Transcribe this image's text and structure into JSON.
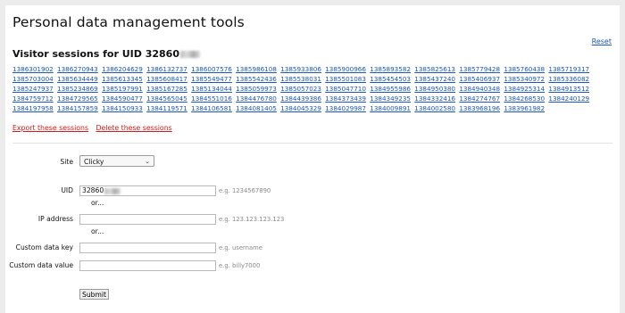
{
  "page": {
    "title": "Personal data management tools",
    "reset_label": "Reset"
  },
  "sessions": {
    "title": "Visitor sessions for UID 32860",
    "ids": [
      "1386301902",
      "1386270943",
      "1386204629",
      "1386132737",
      "1386007576",
      "1385986108",
      "1385933806",
      "1385900966",
      "1385893582",
      "1385825613",
      "1385779428",
      "1385760438",
      "1385719317",
      "1385703004",
      "1385634449",
      "1385613345",
      "1385608417",
      "1385549477",
      "1385542436",
      "1385538031",
      "1385501083",
      "1385454503",
      "1385437240",
      "1385406937",
      "1385340972",
      "1385336082",
      "1385247937",
      "1385234869",
      "1385197991",
      "1385167285",
      "1385134044",
      "1385059973",
      "1385057023",
      "1385047710",
      "1384955986",
      "1384950380",
      "1384940348",
      "1384925314",
      "1384913512",
      "1384759712",
      "1384729565",
      "1384590477",
      "1384565045",
      "1384551016",
      "1384476780",
      "1384439386",
      "1384373439",
      "1384349235",
      "1384332416",
      "1384274767",
      "1384268530",
      "1384240129",
      "1384197958",
      "1384157859",
      "1384150933",
      "1384119571",
      "1384106581",
      "1384081405",
      "1384045329",
      "1384029987",
      "1384009891",
      "1384002580",
      "1383968196",
      "1383961982"
    ]
  },
  "actions": {
    "export_label": "Export these sessions",
    "delete_label": "Delete these sessions"
  },
  "form": {
    "site_label": "Site",
    "site_value": "Clicky",
    "uid_label": "UID",
    "uid_value": "32860",
    "uid_hint": "e.g. 1234567890",
    "or_text": "or...",
    "ip_label": "IP address",
    "ip_value": "",
    "ip_hint": "e.g. 123.123.123.123",
    "custom_key_label": "Custom data key",
    "custom_key_value": "",
    "custom_key_hint": "e.g. username",
    "custom_value_label": "Custom data value",
    "custom_value_value": "",
    "custom_value_hint": "e.g. billy7000",
    "submit_label": "Submit"
  },
  "icons": {
    "site_dropdown": "chevron-down-icon"
  }
}
